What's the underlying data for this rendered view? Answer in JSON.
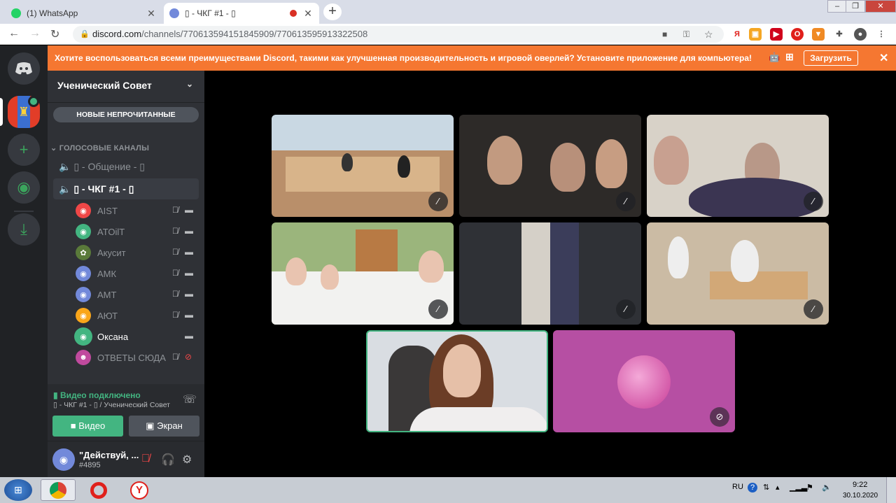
{
  "browser": {
    "tabs": [
      {
        "title": "(1) WhatsApp",
        "active": false,
        "icon": "whatsapp-icon"
      },
      {
        "title": "▯ - ЧКГ #1 - ▯",
        "active": true,
        "icon": "discord-icon"
      }
    ],
    "url_host": "discord.com",
    "url_path": "/channels/770613594151845909/770613595913322508"
  },
  "notice": {
    "text": "Хотите воспользоваться всеми преимуществами Discord, такими как улучшенная производительность и игровой оверлей? Установите приложение для компьютера!",
    "download_label": "Загрузить"
  },
  "server": {
    "name": "Ученический Совет",
    "unread_label": "НОВЫЕ НЕПРОЧИТАННЫЕ",
    "category": "ГОЛОСОВЫЕ КАНАЛЫ",
    "voice_channels": [
      {
        "name": "▯ - Общение - ▯",
        "selected": false
      },
      {
        "name": "▯ - ЧКГ #1 - ▯",
        "selected": true
      }
    ],
    "users": [
      {
        "name": "AIST",
        "avatar_color": "#f04747",
        "muted": true,
        "video": true
      },
      {
        "name": "ATOilT",
        "avatar_color": "#43b581",
        "muted": true,
        "video": true
      },
      {
        "name": "Акусит",
        "avatar_color": "#5a7a3a",
        "muted": true,
        "video": true
      },
      {
        "name": "АМК",
        "avatar_color": "#7289da",
        "muted": true,
        "video": true
      },
      {
        "name": "АМТ",
        "avatar_color": "#7289da",
        "muted": true,
        "video": true
      },
      {
        "name": "АЮТ",
        "avatar_color": "#faa61a",
        "muted": true,
        "video": true
      },
      {
        "name": "Оксана",
        "avatar_color": "#43b581",
        "muted": false,
        "video": true
      },
      {
        "name": "ОТВЕТЫ СЮДА",
        "avatar_color": "#c04a9e",
        "muted": true,
        "video": false
      }
    ]
  },
  "voice_panel": {
    "status": "Видео подключено",
    "location": "▯ - ЧКГ #1 - ▯ / Ученический Совет",
    "video_label": "Видео",
    "screen_label": "Экран"
  },
  "user_panel": {
    "name": "\"Действуй, ...",
    "tag": "#4895"
  },
  "taskbar": {
    "lang": "RU",
    "time": "9:22",
    "date": "30.10.2020"
  },
  "colors": {
    "accent_green": "#43b581",
    "notice_orange": "#f57731",
    "tile_pink": "#b64fa3"
  }
}
